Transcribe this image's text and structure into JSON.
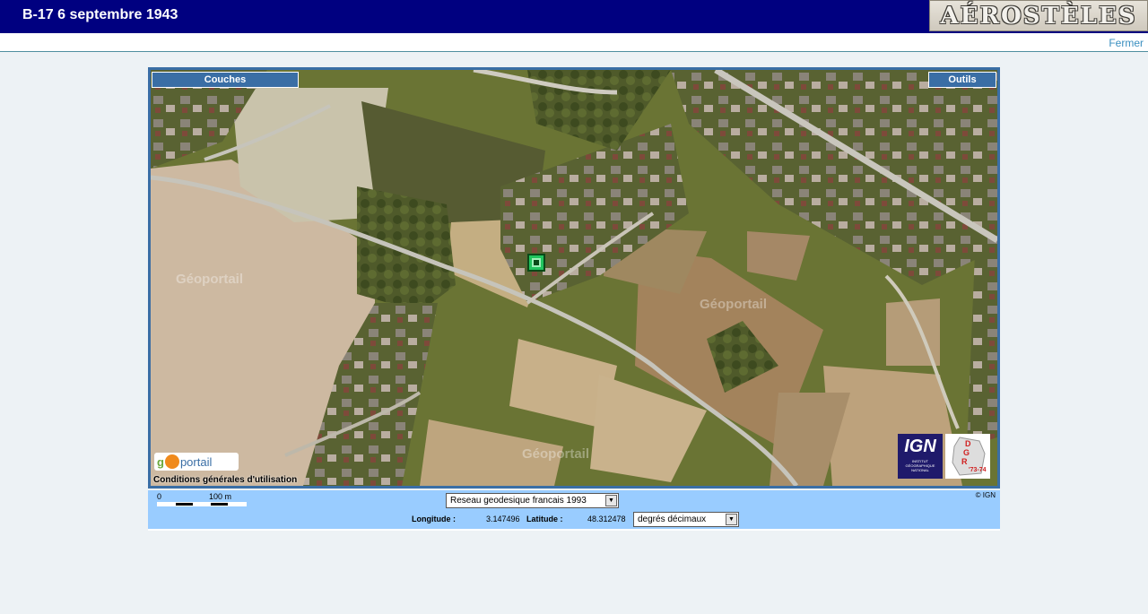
{
  "header": {
    "title": "B-17 6 septembre 1943",
    "logo_text": "AÉROSTÈLES"
  },
  "subbar": {
    "close_label": "Fermer"
  },
  "map": {
    "layers_button": "Couches",
    "tools_button": "Outils",
    "watermark": "Géoportail",
    "geoportail_logo": {
      "prefix": "g",
      "suffix": "portail"
    },
    "terms_link": "Conditions générales d'utilisation",
    "ign_logo": {
      "big": "IGN",
      "small": "INSTITUT GÉOGRAPHIQUE NATIONAL"
    },
    "dgr_logo": {
      "text": "'73-74"
    },
    "marker_icon": "location-marker-icon"
  },
  "coords": {
    "scale_zero": "0",
    "scale_label": "100 m",
    "copyright": "© IGN",
    "datum_value": "Reseau geodesique francais 1993",
    "longitude_label": "Longitude :",
    "longitude_value": "3.147496",
    "latitude_label": "Latitude :",
    "latitude_value": "48.312478",
    "units_value": "degrés décimaux"
  },
  "colors": {
    "header_bg": "#000080",
    "accent": "#3a6ea5",
    "coord_bar_bg": "#99ccff",
    "link": "#3a8fc0"
  }
}
